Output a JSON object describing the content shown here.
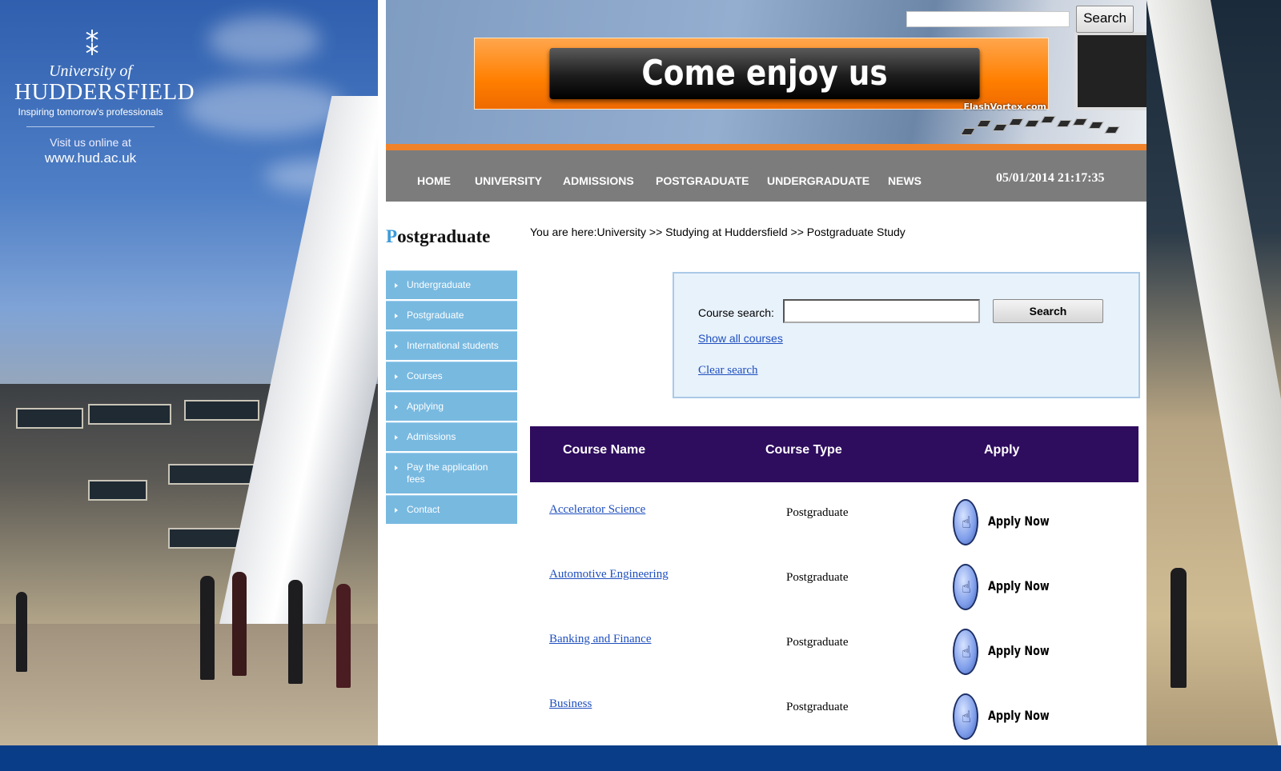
{
  "brand": {
    "logo_mark": "⁑",
    "university_of": "University of",
    "name": "HUDDERSFIELD",
    "tagline": "Inspiring tomorrow's professionals",
    "visit_text": "Visit us online at",
    "url": "www.hud.ac.uk"
  },
  "header": {
    "search_button": "Search",
    "banner_text": "Come enjoy us",
    "banner_credit": "FlashVortex.com"
  },
  "nav": {
    "items": [
      "HOME",
      "UNIVERSITY",
      "ADMISSIONS",
      "POSTGRADUATE",
      "UNDERGRADUATE",
      "NEWS"
    ],
    "datetime": "05/01/2014 21:17:35"
  },
  "section": {
    "title_first": "P",
    "title_rest": "ostgraduate"
  },
  "side_nav": {
    "items": [
      "Undergraduate",
      "Postgraduate",
      "International students",
      "Courses",
      "Applying",
      "Admissions",
      "Pay the application fees",
      "Contact"
    ]
  },
  "breadcrumb": "You are here:University >> Studying at Huddersfield >> Postgraduate Study",
  "course_search": {
    "label": "Course search:",
    "value": "",
    "button": "Search",
    "show_all": " Show all courses",
    "clear": "Clear search"
  },
  "table": {
    "headers": [
      "Course Name",
      "Course Type",
      "Apply"
    ],
    "rows": [
      {
        "name": "Accelerator Science",
        "type": "Postgraduate",
        "apply": "Apply Now"
      },
      {
        "name": "Automotive Engineering",
        "type": "Postgraduate",
        "apply": "Apply Now"
      },
      {
        "name": "Banking and Finance",
        "type": "Postgraduate",
        "apply": "Apply Now"
      },
      {
        "name": "Business",
        "type": "Postgraduate",
        "apply": "Apply Now"
      }
    ]
  },
  "colors": {
    "nav_bg": "#7c7c7c",
    "accent_orange": "#f0822a",
    "side_nav_bg": "#78b9e0",
    "table_head_bg": "#2e0c5e",
    "link": "#1f4fbf",
    "title_accent": "#3a9ad9"
  },
  "icons": {
    "apply": "hand-pointer-icon",
    "side_bullet": "triangle-right-icon",
    "logo": "university-crest-icon"
  }
}
